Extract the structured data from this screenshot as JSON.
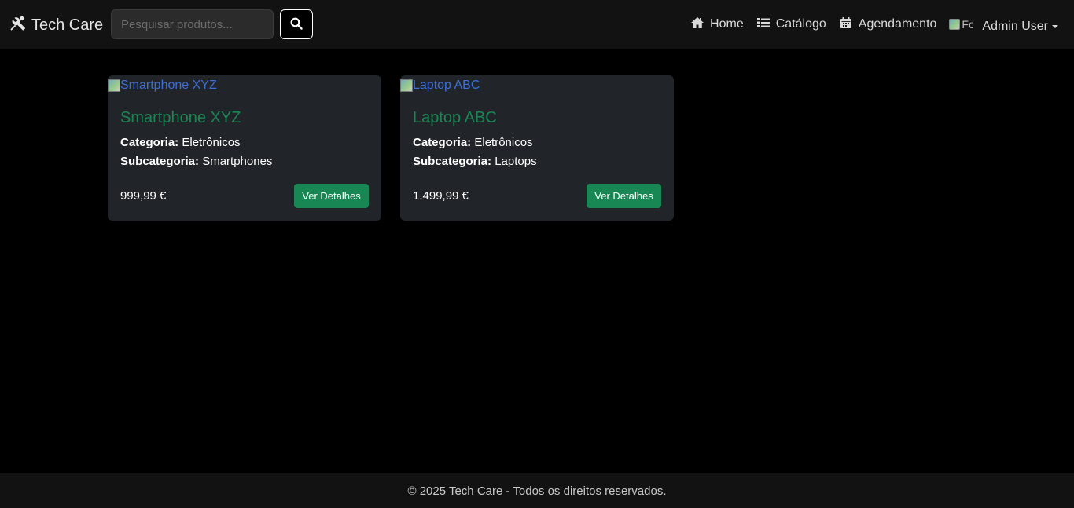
{
  "navbar": {
    "brand": "Tech Care",
    "search": {
      "placeholder": "Pesquisar produtos...",
      "value": ""
    },
    "links": [
      {
        "label": "Home",
        "icon": "home-icon"
      },
      {
        "label": "Catálogo",
        "icon": "list-icon"
      },
      {
        "label": "Agendamento",
        "icon": "calendar-icon"
      }
    ],
    "avatar_alt": "Fo",
    "user": "Admin User"
  },
  "products": [
    {
      "image_alt": "Smartphone XYZ",
      "title": "Smartphone XYZ",
      "category_label": "Categoria:",
      "category": "Eletrônicos",
      "subcategory_label": "Subcategoria:",
      "subcategory": "Smartphones",
      "price": "999,99 €",
      "button": "Ver Detalhes"
    },
    {
      "image_alt": "Laptop ABC",
      "title": "Laptop ABC",
      "category_label": "Categoria:",
      "category": "Eletrônicos",
      "subcategory_label": "Subcategoria:",
      "subcategory": "Laptops",
      "price": "1.499,99 €",
      "button": "Ver Detalhes"
    }
  ],
  "footer": {
    "text": "© 2025 Tech Care - Todos os direitos reservados."
  },
  "colors": {
    "accent": "#198754",
    "card_bg": "#212529",
    "nav_bg": "#121212",
    "link": "#3d6fd6"
  }
}
